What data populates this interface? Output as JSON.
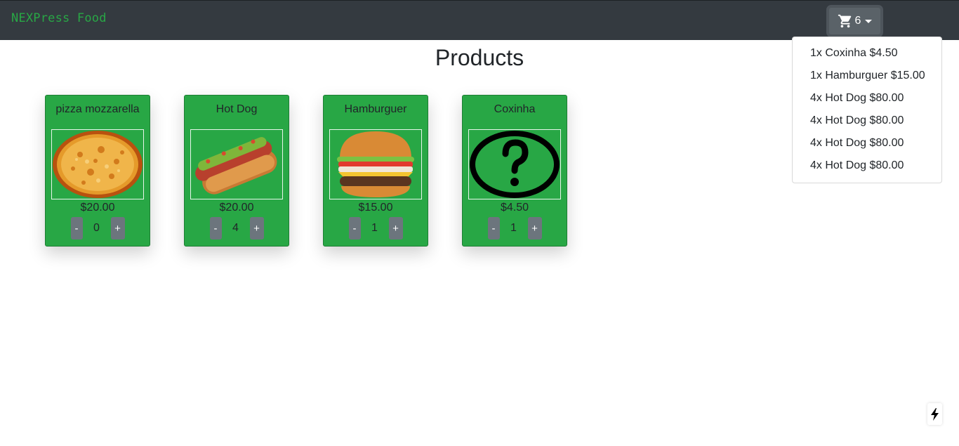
{
  "brand": "NEXPress Food",
  "cart": {
    "count": "6",
    "icon": "cart-icon"
  },
  "cart_items": [
    "1x Coxinha $4.50",
    "1x Hamburguer $15.00",
    "4x Hot Dog $80.00",
    "4x Hot Dog $80.00",
    "4x Hot Dog $80.00",
    "4x Hot Dog $80.00"
  ],
  "page_title": "Products",
  "products": [
    {
      "name": "pizza mozzarella",
      "price": "$20.00",
      "quantity": "0",
      "minus": "-",
      "plus": "+",
      "image": "pizza-image"
    },
    {
      "name": "Hot Dog",
      "price": "$20.00",
      "quantity": "4",
      "minus": "-",
      "plus": "+",
      "image": "hot-dog-image"
    },
    {
      "name": "Hamburguer",
      "price": "$15.00",
      "quantity": "1",
      "minus": "-",
      "plus": "+",
      "image": "hamburger-image"
    },
    {
      "name": "Coxinha",
      "price": "$4.50",
      "quantity": "1",
      "minus": "-",
      "plus": "+",
      "image": "question-mark-image"
    }
  ],
  "colors": {
    "navbar": "#343a40",
    "brand": "#28a745",
    "card": "#28a745",
    "button": "#6c757d"
  }
}
